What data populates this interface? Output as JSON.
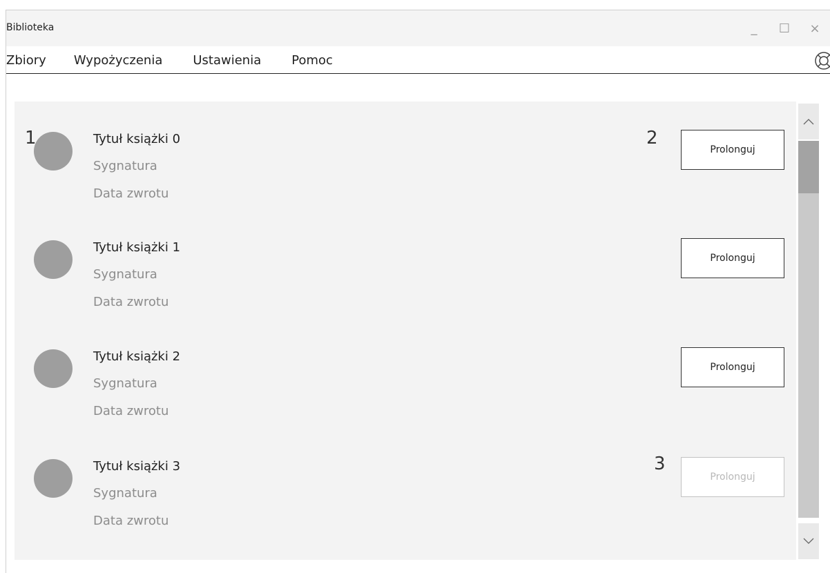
{
  "window": {
    "title": "Biblioteka",
    "controls": {
      "minimize": "_",
      "maximize": "☐",
      "close": "×"
    }
  },
  "menu": {
    "items": [
      "Zbiory",
      "Wypożyczenia",
      "Ustawienia",
      "Pomoc"
    ],
    "help_icon": "lifebuoy-icon"
  },
  "loans": {
    "items": [
      {
        "title": "Tytuł książki 0",
        "signature": "Sygnatura",
        "return_date": "Data zwrotu",
        "button": "Prolonguj",
        "enabled": true
      },
      {
        "title": "Tytuł książki 1",
        "signature": "Sygnatura",
        "return_date": "Data zwrotu",
        "button": "Prolonguj",
        "enabled": true
      },
      {
        "title": "Tytuł książki 2",
        "signature": "Sygnatura",
        "return_date": "Data zwrotu",
        "button": "Prolonguj",
        "enabled": true
      },
      {
        "title": "Tytuł książki 3",
        "signature": "Sygnatura",
        "return_date": "Data zwrotu",
        "button": "Prolonguj",
        "enabled": false
      }
    ]
  },
  "annotations": [
    "1",
    "2",
    "3"
  ],
  "scrollbar": {
    "up_icon": "chevron-up-icon",
    "down_icon": "chevron-down-icon"
  },
  "colors": {
    "panel": "#f3f3f3",
    "avatar": "#9e9e9e",
    "disabled": "#b8b8b8"
  }
}
